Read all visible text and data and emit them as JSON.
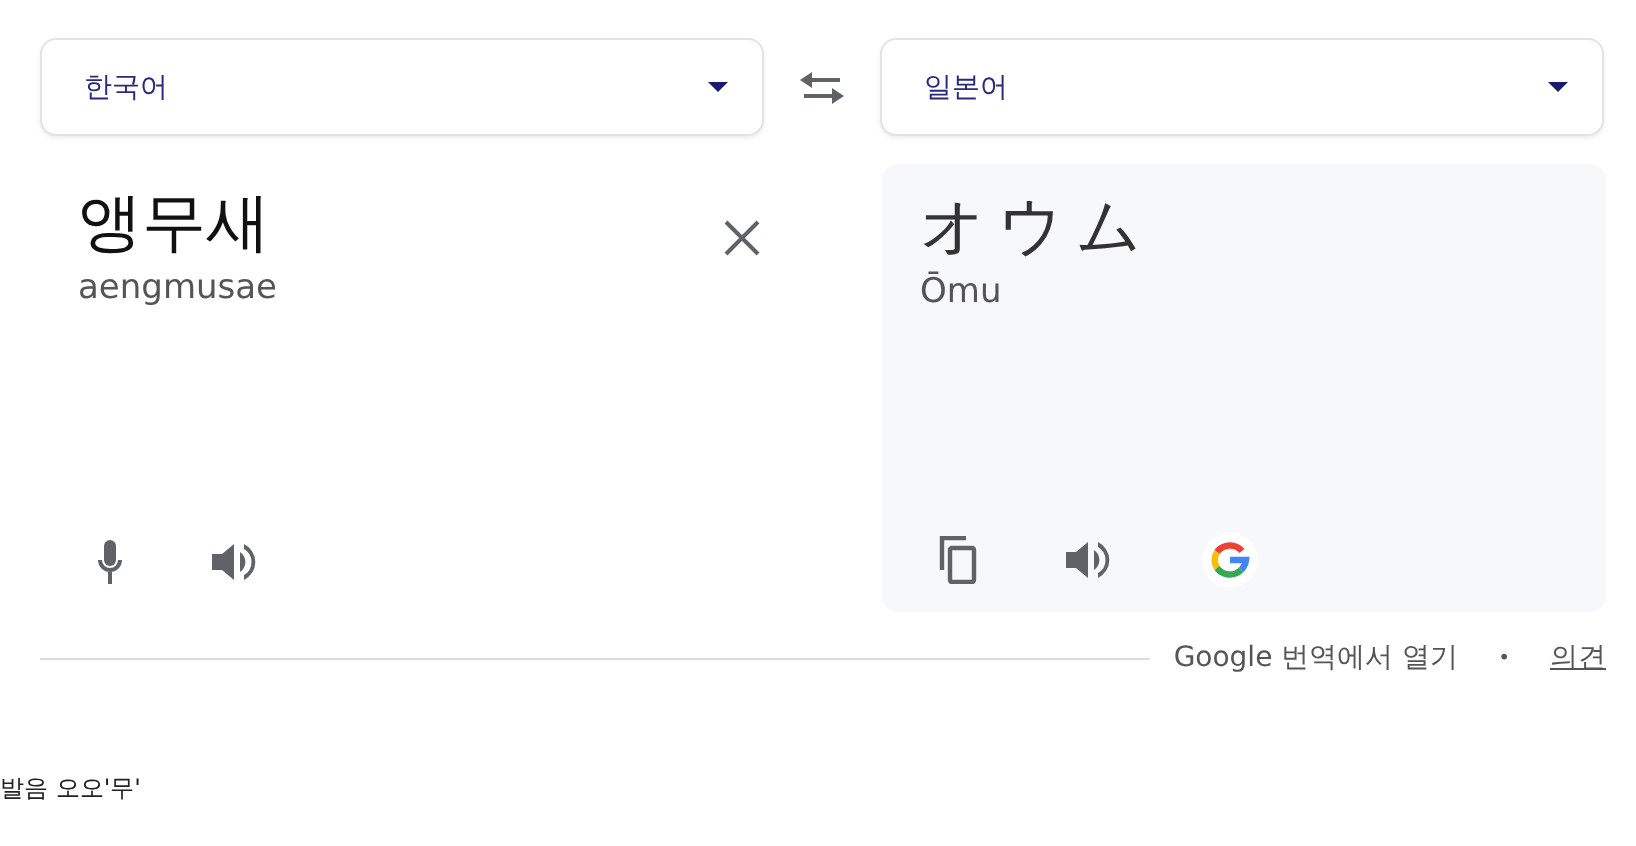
{
  "source_language": {
    "label": "한국어"
  },
  "target_language": {
    "label": "일본어"
  },
  "source": {
    "text": "앵무새",
    "romanization": "aengmusae"
  },
  "target": {
    "text": "オウム",
    "romanization": "Ōmu"
  },
  "footer": {
    "open_link": "Google 번역에서 열기",
    "separator": "•",
    "feedback_link": "의견"
  },
  "note": "발음 오오'무'"
}
